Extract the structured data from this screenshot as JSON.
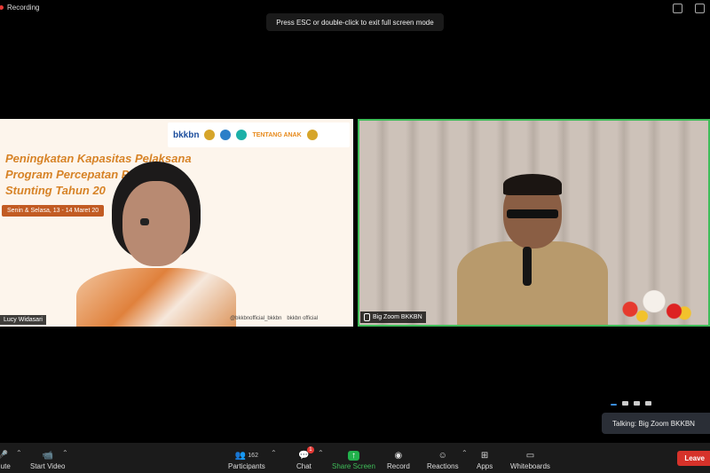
{
  "status": {
    "recording_label": "Recording"
  },
  "banner": {
    "text": "Press ESC or double-click to exit full screen mode"
  },
  "slide": {
    "logo_text": "bkkbn",
    "logo_tentang": "TENTANG ANAK",
    "title_line1": "Peningkatan Kapasitas Pelaksana",
    "title_line2": "Program Percepatan Penurunan",
    "title_line3": "Stunting Tahun 20",
    "date": "Senin & Selasa, 13 - 14 Maret 20",
    "social_1": "@bkkbnofficial_bkkbn",
    "social_2": "bkkbn official"
  },
  "participants": {
    "left": {
      "name": "Lucy Widasari"
    },
    "right": {
      "name": "Big Zoom BKKBN"
    }
  },
  "talking": {
    "text": "Talking: Big Zoom BKKBN"
  },
  "toolbar": {
    "mute_label": "Mute",
    "video_label": "Start Video",
    "participants_label": "Participants",
    "participants_count": "162",
    "chat_label": "Chat",
    "chat_badge": "1",
    "share_label": "Share Screen",
    "record_label": "Record",
    "reactions_label": "Reactions",
    "apps_label": "Apps",
    "whiteboards_label": "Whiteboards",
    "leave_label": "Leave"
  },
  "colors": {
    "accent_green": "#3fbd59",
    "share_green": "#22b14c",
    "leave_red": "#d6322a",
    "recording_red": "#e53935"
  },
  "icons": [
    "recording-dot",
    "minimize-icon",
    "grid-view-icon",
    "mic-icon",
    "video-off-icon",
    "participants-icon",
    "chat-icon",
    "share-screen-icon",
    "record-icon",
    "reactions-icon",
    "apps-icon",
    "whiteboards-icon"
  ]
}
